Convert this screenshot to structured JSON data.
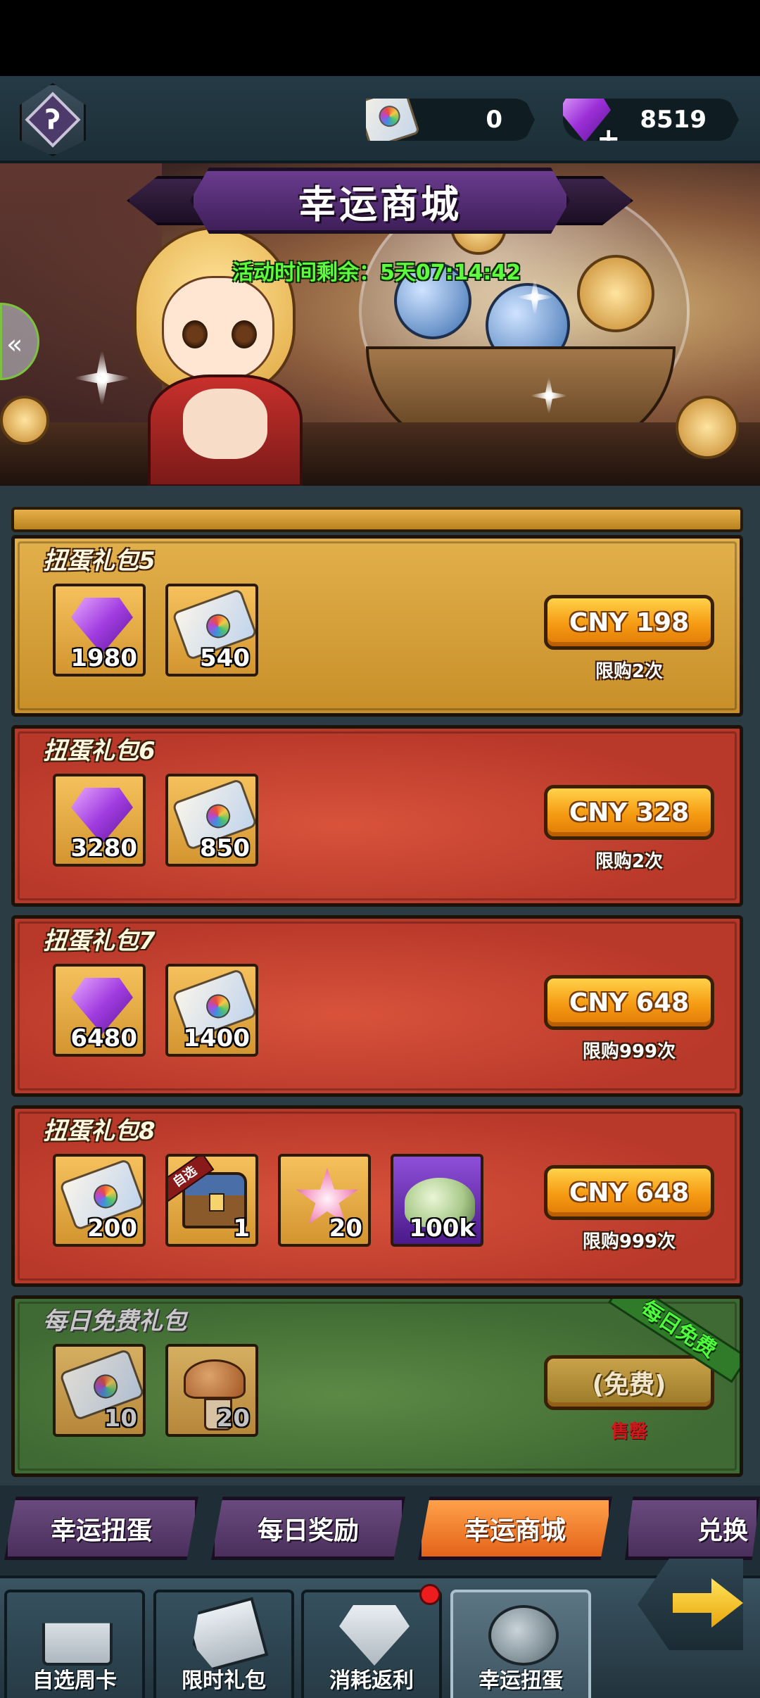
{
  "header": {
    "corner_glyph": "ʔ",
    "currencies": [
      {
        "icon": "ticket-icon",
        "value": "0"
      },
      {
        "icon": "gem-plus-icon",
        "value": "8519"
      }
    ]
  },
  "banner": {
    "title": "幸运商城",
    "timer": "活动时间剩余：5天07:14:42"
  },
  "packs": [
    {
      "name": "扭蛋礼包5",
      "theme": "gold",
      "items": [
        {
          "icon": "gem-icon",
          "qty": "1980"
        },
        {
          "icon": "ticket-icon",
          "qty": "540"
        }
      ],
      "price": "CNY 198",
      "limit": "限购2次"
    },
    {
      "name": "扭蛋礼包6",
      "theme": "red",
      "items": [
        {
          "icon": "gem-icon",
          "qty": "3280"
        },
        {
          "icon": "ticket-icon",
          "qty": "850"
        }
      ],
      "price": "CNY 328",
      "limit": "限购2次"
    },
    {
      "name": "扭蛋礼包7",
      "theme": "red",
      "items": [
        {
          "icon": "gem-icon",
          "qty": "6480"
        },
        {
          "icon": "ticket-icon",
          "qty": "1400"
        }
      ],
      "price": "CNY 648",
      "limit": "限购999次"
    },
    {
      "name": "扭蛋礼包8",
      "theme": "red",
      "items": [
        {
          "icon": "ticket-icon",
          "qty": "200"
        },
        {
          "icon": "chest-icon",
          "qty": "1",
          "tag": "自选"
        },
        {
          "icon": "star-icon",
          "qty": "20"
        },
        {
          "icon": "dust-icon",
          "qty": "100k"
        }
      ],
      "price": "CNY 648",
      "limit": "限购999次"
    },
    {
      "name": "每日免费礼包",
      "theme": "green",
      "items": [
        {
          "icon": "ticket-icon",
          "qty": "10"
        },
        {
          "icon": "mushroom-icon",
          "qty": "20"
        }
      ],
      "price": "(免费)",
      "limit": "售罄",
      "ribbon": "每日免费"
    }
  ],
  "tabs": [
    {
      "label": "幸运扭蛋",
      "active": false
    },
    {
      "label": "每日奖励",
      "active": false
    },
    {
      "label": "幸运商城",
      "active": true
    },
    {
      "label": "兑换",
      "active": false
    }
  ],
  "bottom_nav": [
    {
      "label": "自选周卡",
      "icon": "gift-icon",
      "active": false
    },
    {
      "label": "限时礼包",
      "icon": "discount-tag-icon",
      "active": false
    },
    {
      "label": "消耗返利",
      "icon": "diamond-icon",
      "active": false,
      "notification": true
    },
    {
      "label": "幸运扭蛋",
      "icon": "capsule-icon",
      "active": true
    }
  ],
  "colors": {
    "accent_orange": "#f59a12",
    "timer_green": "#5dff3d",
    "pack_gold": "#e2b04b",
    "pack_red": "#c8452f",
    "pack_green": "#4d7a3c",
    "tab_purple": "#5a3b6e",
    "tab_active": "#f07a2c"
  }
}
